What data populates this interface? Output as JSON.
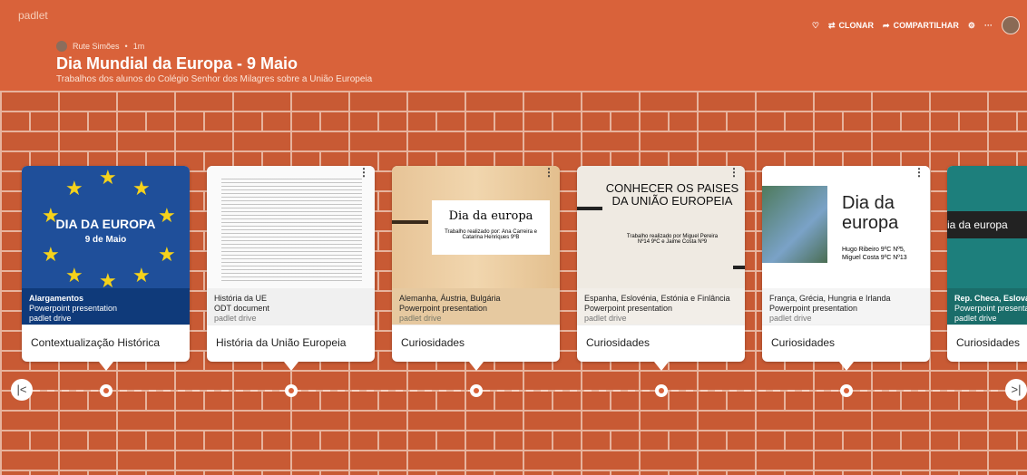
{
  "app": {
    "name": "padlet"
  },
  "header": {
    "author": "Rute Simões",
    "time": "1m",
    "title": "Dia Mundial da Europa - 9 Maio",
    "subtitle": "Trabalhos dos alunos do Colégio Senhor dos Milagres sobre a União Europeia"
  },
  "actions": {
    "clone": "CLONAR",
    "share": "COMPARTILHAR"
  },
  "cards": [
    {
      "thumb_text": "DIA DA EUROPA",
      "thumb_sub": "9 de Maio",
      "meta_title": "Alargamentos",
      "meta_type": "Powerpoint presentation",
      "meta_src": "padlet drive",
      "caption": "Contextualização Histórica"
    },
    {
      "thumb_text": "",
      "thumb_sub": "",
      "meta_title": "História da UE",
      "meta_type": "ODT document",
      "meta_src": "padlet drive",
      "caption": "História da União Europeia"
    },
    {
      "thumb_text": "Dia da europa",
      "thumb_sub": "Trabalho realizado por: Ana Carreira e Catarina Henriques 9ºB",
      "meta_title": "Alemanha, Áustria, Bulgária",
      "meta_type": "Powerpoint presentation",
      "meta_src": "padlet drive",
      "caption": "Curiosidades"
    },
    {
      "thumb_text": "CONHECER OS PAISES DA UNIÃO EUROPEIA",
      "thumb_sub": "Trabalho realizado por Miguel Pereira Nº14 9ºC e Jaime Costa Nº9",
      "meta_title": "Espanha, Eslovénia, Estónia e Finlância",
      "meta_type": "Powerpoint presentation",
      "meta_src": "padlet drive",
      "caption": "Curiosidades"
    },
    {
      "thumb_text": "Dia da europa",
      "thumb_sub": "Hugo Ribeiro 9ºC Nº5, Miguel Costa 9ºC Nº13",
      "meta_title": "França, Grécia, Hungria e Irlanda",
      "meta_type": "Powerpoint presentation",
      "meta_src": "padlet drive",
      "caption": "Curiosidades"
    },
    {
      "thumb_text": "ia da europa",
      "thumb_sub": "",
      "meta_title": "Rep. Checa, Eslovác",
      "meta_type": "Powerpoint presenta",
      "meta_src": "padlet drive",
      "caption": "Curiosidades"
    }
  ],
  "nav": {
    "prev": "|<",
    "next": ">|"
  }
}
